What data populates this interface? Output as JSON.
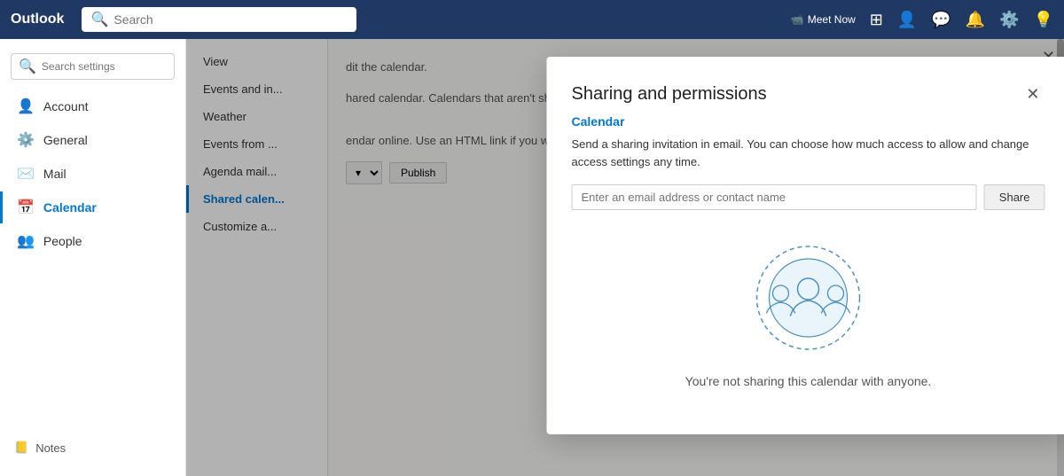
{
  "topbar": {
    "logo": "Outlook",
    "search_placeholder": "Search",
    "meet_now": "Meet Now",
    "icons": [
      "video-icon",
      "people-icon",
      "chat-icon",
      "bell-icon",
      "settings-icon",
      "help-icon"
    ]
  },
  "sidebar": {
    "search_placeholder": "Search settings",
    "items": [
      {
        "id": "account",
        "label": "Account",
        "icon": "👤"
      },
      {
        "id": "general",
        "label": "General",
        "icon": "⚙️"
      },
      {
        "id": "mail",
        "label": "Mail",
        "icon": "✉️"
      },
      {
        "id": "calendar",
        "label": "Calendar",
        "icon": "📅",
        "active": true
      },
      {
        "id": "people",
        "label": "People",
        "icon": "👥"
      }
    ],
    "notes": {
      "icon": "📒",
      "label": "Notes"
    }
  },
  "settings_nav": {
    "items": [
      {
        "id": "view",
        "label": "View"
      },
      {
        "id": "events-invitations",
        "label": "Events and in..."
      },
      {
        "id": "weather",
        "label": "Weather"
      },
      {
        "id": "events-from",
        "label": "Events from ..."
      },
      {
        "id": "agenda-mail",
        "label": "Agenda mail..."
      },
      {
        "id": "shared-calendars",
        "label": "Shared calen...",
        "active": true
      },
      {
        "id": "customize",
        "label": "Customize a..."
      }
    ]
  },
  "right_panel": {
    "text1": "dit the calendar.",
    "text2": "hared calendar. Calendars that aren't shared ay aren't listed below.",
    "text3": "endar online. Use an HTML link if you want e.",
    "publish_select_option": "▾",
    "publish_label": "Publish"
  },
  "modal": {
    "title": "Sharing and permissions",
    "close_label": "✕",
    "subtitle": "Calendar",
    "description": "Send a sharing invitation in email. You can choose how much access to allow and change access settings any time.",
    "email_placeholder": "Enter an email address or contact name",
    "share_button": "Share",
    "empty_state_text": "You're not sharing this calendar with anyone."
  },
  "settings_close": "✕"
}
